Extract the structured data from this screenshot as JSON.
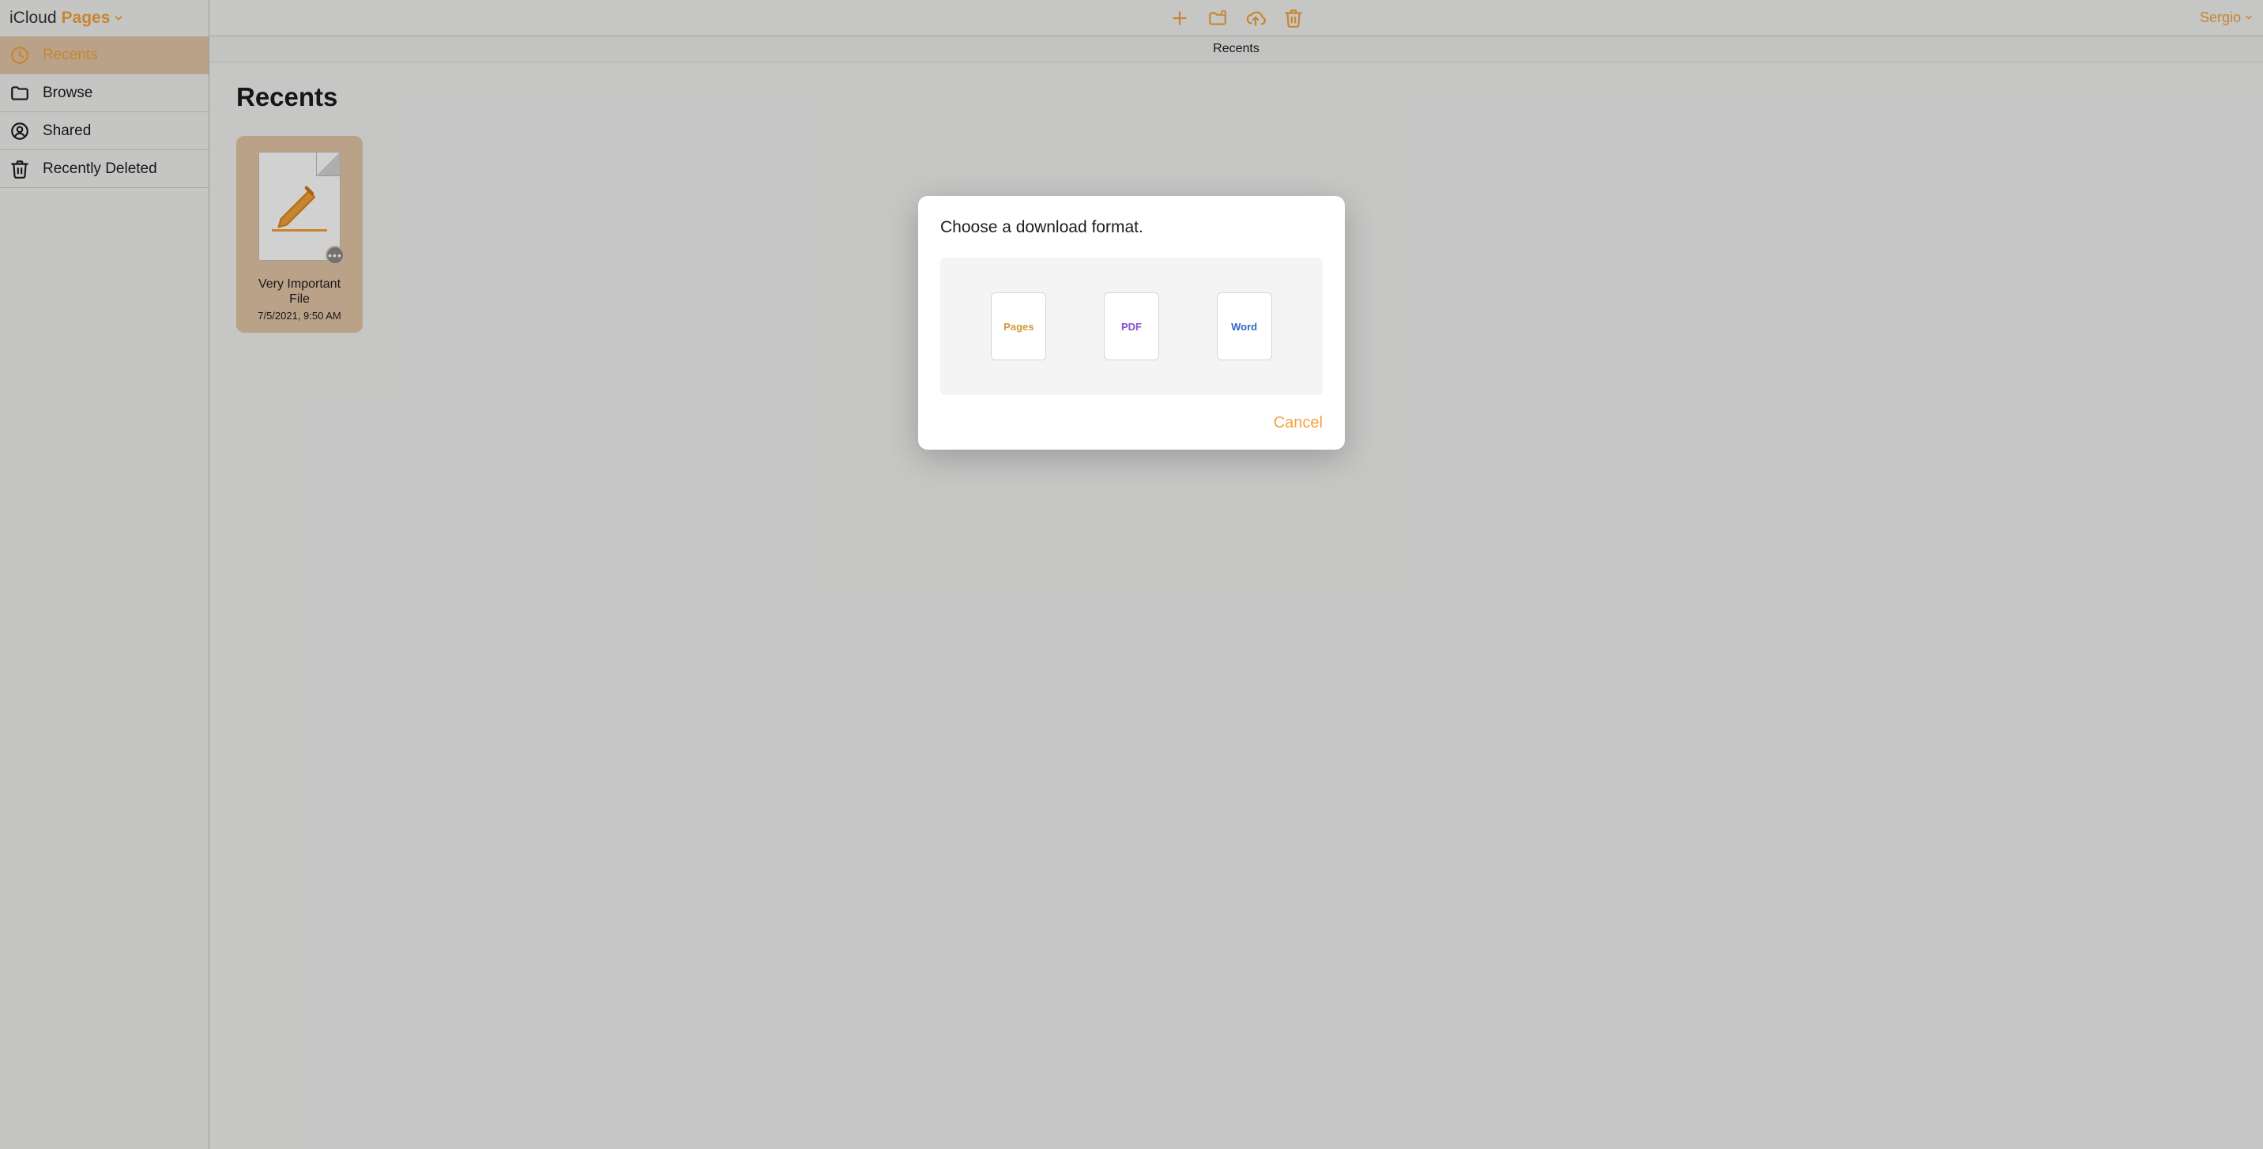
{
  "brand": {
    "icloud": "iCloud",
    "app": "Pages"
  },
  "sidebar": {
    "items": [
      {
        "key": "recents",
        "label": "Recents"
      },
      {
        "key": "browse",
        "label": "Browse"
      },
      {
        "key": "shared",
        "label": "Shared"
      },
      {
        "key": "recently-deleted",
        "label": "Recently Deleted"
      }
    ]
  },
  "header": {
    "user": "Sergio",
    "subheader": "Recents"
  },
  "page": {
    "title": "Recents"
  },
  "documents": [
    {
      "title": "Very Important File",
      "date": "7/5/2021, 9:50 AM"
    }
  ],
  "dialog": {
    "title": "Choose a download format.",
    "formats": [
      {
        "key": "pages",
        "label": "Pages"
      },
      {
        "key": "pdf",
        "label": "PDF"
      },
      {
        "key": "word",
        "label": "Word"
      }
    ],
    "cancel": "Cancel"
  },
  "colors": {
    "accent": "#f2a33c",
    "selectionBg": "#e3c6a8"
  }
}
